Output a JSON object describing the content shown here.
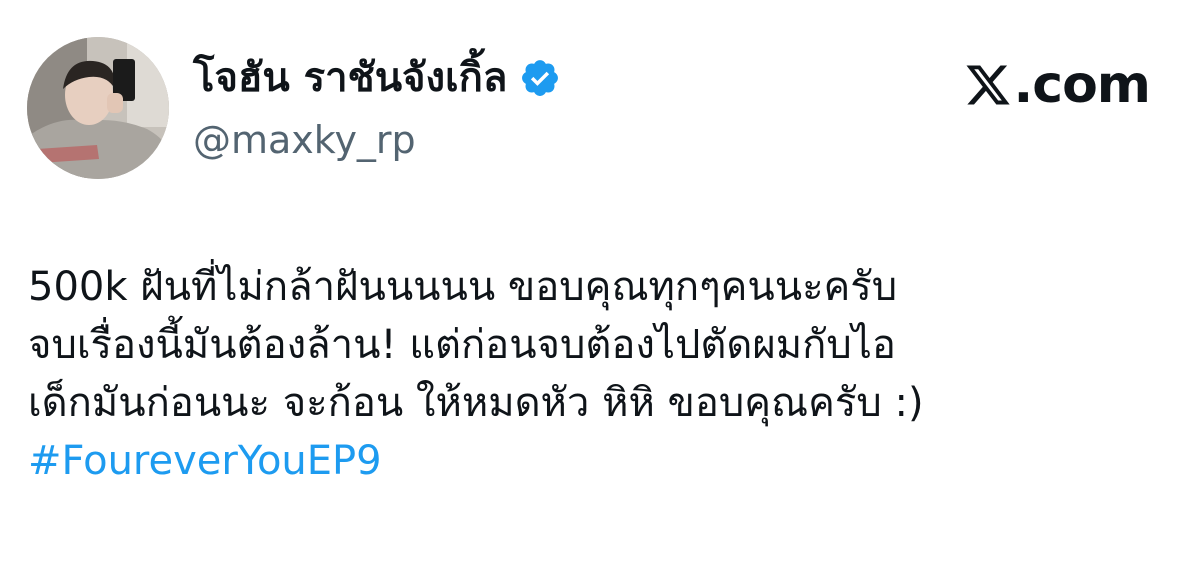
{
  "tweet": {
    "author": {
      "display_name": "โจฮัน ราชันจังเกิ้ล",
      "handle": "@maxky_rp",
      "verified_icon": "verified-badge-icon",
      "avatar_icon": "profile-photo"
    },
    "brand": {
      "icon": "x-logo-icon",
      "text": ".com"
    },
    "body_lines": [
      "500k ฝันที่ไม่กล้าฝันนนนน ขอบคุณทุกๆคนนะครับ",
      "จบเรื่องนี้มันต้องล้าน! แต่ก่อนจบต้องไปตัดผมกับไอ",
      "เด็กมันก่อนนะ จะก้อน ให้หมดหัว หิหิ ขอบคุณครับ :)"
    ],
    "hashtag": "#FoureverYouEP9"
  },
  "colors": {
    "text": "#0f1419",
    "secondary_text": "#536471",
    "link": "#1d9bf0",
    "verified": "#1d9bf0"
  }
}
